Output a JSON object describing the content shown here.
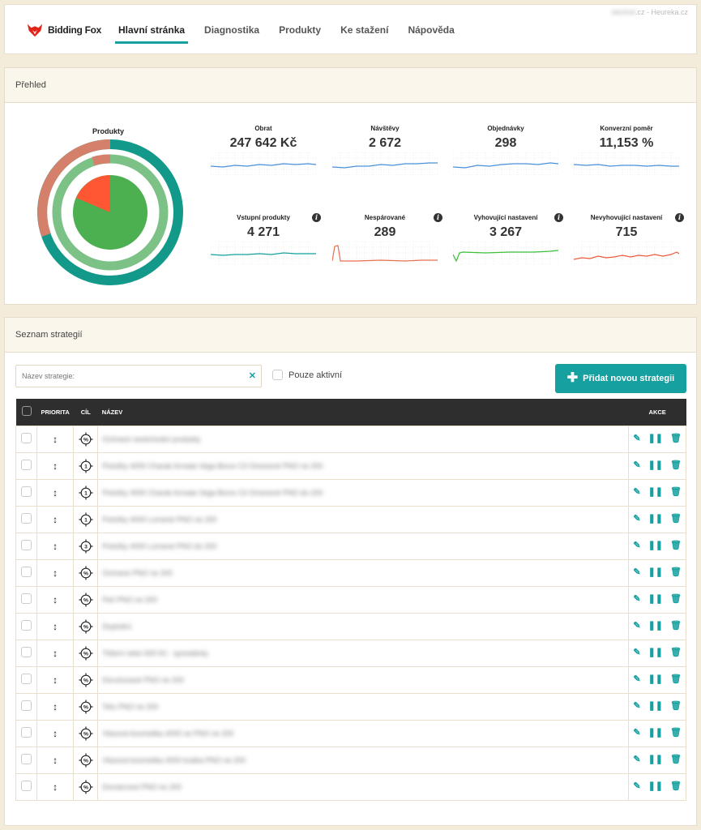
{
  "app": {
    "logo_text": "Bidding Fox",
    "top_right": ".cz - Heureka.cz",
    "top_right_blurred": "obchod"
  },
  "nav": {
    "items": [
      {
        "label": "Hlavní stránka",
        "active": true
      },
      {
        "label": "Diagnostika",
        "active": false
      },
      {
        "label": "Produkty",
        "active": false
      },
      {
        "label": "Ke stažení",
        "active": false
      },
      {
        "label": "Nápověda",
        "active": false
      }
    ]
  },
  "overview": {
    "title": "Přehled",
    "donut": {
      "title": "Produkty",
      "colors": {
        "outer": "#13998a",
        "middle": "#7cc287",
        "inner": "#4caf50",
        "accent": "#d4806a",
        "red": "#ff5733"
      }
    },
    "stats": [
      {
        "label": "Obrat",
        "value": "247 642 Kč",
        "color": "#4a90d9",
        "info": false
      },
      {
        "label": "Návštěvy",
        "value": "2 672",
        "color": "#4a90d9",
        "info": false
      },
      {
        "label": "Objednávky",
        "value": "298",
        "color": "#4a90d9",
        "info": false
      },
      {
        "label": "Konverzní poměr",
        "value": "11,153 %",
        "color": "#4a90d9",
        "info": false
      },
      {
        "label": "Vstupní produkty",
        "value": "4 271",
        "color": "#16a0a0",
        "info": true
      },
      {
        "label": "Nespárované",
        "value": "289",
        "color": "#e8704f",
        "info": true
      },
      {
        "label": "Vyhovující nastavení",
        "value": "3 267",
        "color": "#3bbf3b",
        "info": true
      },
      {
        "label": "Nevyhovující nastavení",
        "value": "715",
        "color": "#ee5a3c",
        "info": true
      }
    ]
  },
  "strategies": {
    "title": "Seznam strategií",
    "search_placeholder": "Název strategie:",
    "only_active_label": "Pouze aktivní",
    "add_button_label": "Přidat novou strategii",
    "columns": {
      "priority": "PRIORITA",
      "goal": "CÍL",
      "name": "NÁZEV",
      "actions": "AKCE"
    },
    "rows": [
      {
        "goal": "%",
        "name": "Ochrané neobchodní produkty"
      },
      {
        "goal": "1",
        "name": "Položky 4000 Charak Armata Vega Borov Cil Omezené PNO ne 200"
      },
      {
        "goal": "1",
        "name": "Položky 4000 Charak Armata Vega Borov Cil Omezené PNO do 200"
      },
      {
        "goal": "1",
        "name": "Položky 4000 Lomené PNO ne 200"
      },
      {
        "goal": "3",
        "name": "Položky 4000 Lomené PNO do 200"
      },
      {
        "goal": "%",
        "name": "Ochrane PNO ne 200"
      },
      {
        "goal": "%",
        "name": "Pelí PNO ne 200"
      },
      {
        "goal": "%",
        "name": "Doplnění"
      },
      {
        "goal": "%",
        "name": "Tištení nebo 600 Kč - sporadicky"
      },
      {
        "goal": "%",
        "name": "Doručované PNO ne 200"
      },
      {
        "goal": "%",
        "name": "Tofu PNO ne 200"
      },
      {
        "goal": "%",
        "name": "Vlasová kosmetika 4000 ne PNO ne 200"
      },
      {
        "goal": "%",
        "name": "Vlasová kosmetika 4000 kratka PNO ne 200"
      },
      {
        "goal": "%",
        "name": "Domácnost PNO ne 200"
      }
    ]
  }
}
